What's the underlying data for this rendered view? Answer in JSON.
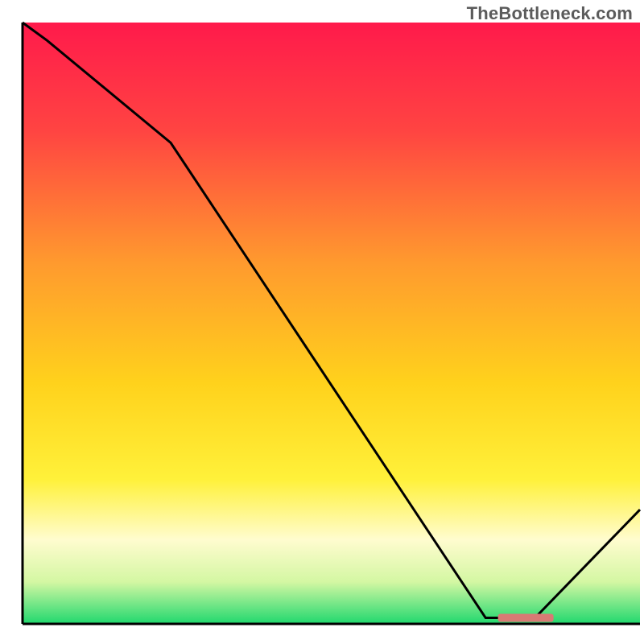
{
  "watermark": "TheBottleneck.com",
  "chart_data": {
    "type": "line",
    "title": "",
    "xlabel": "",
    "ylabel": "",
    "xlim": [
      0,
      100
    ],
    "ylim": [
      0,
      100
    ],
    "x": [
      0,
      4,
      24,
      75,
      83,
      100
    ],
    "values": [
      100,
      97,
      80,
      1,
      1,
      19
    ],
    "marker": {
      "x_start": 77,
      "x_end": 86,
      "y": 1,
      "color": "#d87a74"
    },
    "gradient_stops": [
      {
        "pct": 0,
        "color": "#ff1a4b"
      },
      {
        "pct": 18,
        "color": "#ff4442"
      },
      {
        "pct": 40,
        "color": "#ff9a2e"
      },
      {
        "pct": 60,
        "color": "#ffd21c"
      },
      {
        "pct": 76,
        "color": "#fff13a"
      },
      {
        "pct": 86,
        "color": "#fffccf"
      },
      {
        "pct": 93,
        "color": "#d4f7a3"
      },
      {
        "pct": 100,
        "color": "#20d86e"
      }
    ],
    "axis_color": "#000000",
    "line_color": "#000000"
  }
}
